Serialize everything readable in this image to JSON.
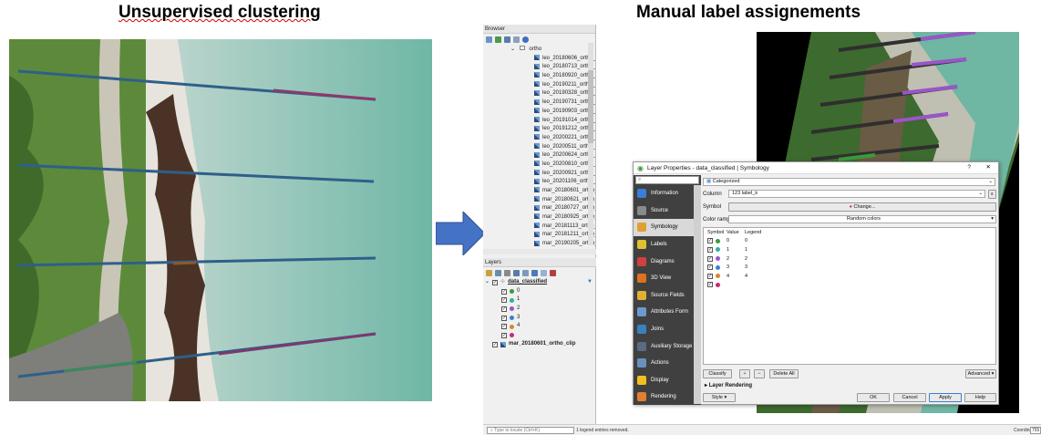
{
  "titles": {
    "left": "Unsupervised clustering",
    "right": "Manual label assignements"
  },
  "browser_panel": {
    "header": "Browser",
    "folder": "ortho",
    "items": [
      "leo_20180606_ortho_",
      "leo_20180713_ortho_",
      "leo_20180920_ortho_",
      "leo_20190211_ortho_",
      "leo_20190328_ortho_",
      "leo_20190731_ortho_",
      "leo_20190903_ortho_",
      "leo_20191014_ortho_",
      "leo_20191212_ortho_",
      "leo_20200221_ortho_",
      "leo_20200511_ortho_",
      "leo_20200624_ortho_",
      "leo_20200810_ortho_",
      "leo_20200921_ortho_",
      "leo_20201106_ortho_",
      "mar_20180601_ortho_",
      "mar_20180621_ortho_",
      "mar_20180727_ortho_",
      "mar_20180925_ortho_",
      "mar_20181113_ortho_",
      "mar_20181211_ortho_",
      "mar_20190205_ortho_"
    ]
  },
  "layers_panel": {
    "header": "Layers",
    "main_layer": "data_classified",
    "classes": [
      {
        "label": "0",
        "color": "#3a9a3a"
      },
      {
        "label": "1",
        "color": "#2fb0a0"
      },
      {
        "label": "2",
        "color": "#9a55c8"
      },
      {
        "label": "3",
        "color": "#3a7fd0"
      },
      {
        "label": "4",
        "color": "#d08a2a"
      },
      {
        "label": "",
        "color": "#c8287a"
      }
    ],
    "raster_layer": "mar_20180601_ortho_clip"
  },
  "statusbar": {
    "locate_placeholder": "Type to locate (Ctrl+K)",
    "message": "1 legend entries removed.",
    "coord_label": "Coordinate",
    "coord_value": "755"
  },
  "dialog": {
    "title": "Layer Properties - data_classified | Symbology",
    "help": "?",
    "close": "✕",
    "renderer": "Categorized",
    "column_label": "Column",
    "column_value": "123 label_k",
    "symbol_label": "Symbol",
    "symbol_value": "Change...",
    "ramp_label": "Color ramp",
    "ramp_value": "Random colors",
    "table_headers": [
      "Symbol",
      "Value",
      "Legend"
    ],
    "rows": [
      {
        "value": "0",
        "legend": "0",
        "color": "#3a9a3a"
      },
      {
        "value": "1",
        "legend": "1",
        "color": "#2fb0a0"
      },
      {
        "value": "2",
        "legend": "2",
        "color": "#9a55c8"
      },
      {
        "value": "3",
        "legend": "3",
        "color": "#3a7fd0"
      },
      {
        "value": "4",
        "legend": "4",
        "color": "#d08a2a"
      },
      {
        "value": "",
        "legend": "",
        "color": "#c8287a"
      }
    ],
    "sidebar": [
      {
        "label": "Information",
        "color": "#3b7dd8"
      },
      {
        "label": "Source",
        "color": "#8a8a8a"
      },
      {
        "label": "Symbology",
        "color": "#e0a030"
      },
      {
        "label": "Labels",
        "color": "#e0c030"
      },
      {
        "label": "Diagrams",
        "color": "#d04040"
      },
      {
        "label": "3D View",
        "color": "#e07020"
      },
      {
        "label": "Source Fields",
        "color": "#e0b030"
      },
      {
        "label": "Attributes Form",
        "color": "#6a9ad0"
      },
      {
        "label": "Joins",
        "color": "#3a80c0"
      },
      {
        "label": "Auxiliary Storage",
        "color": "#5a6a80"
      },
      {
        "label": "Actions",
        "color": "#6a90c0"
      },
      {
        "label": "Display",
        "color": "#f0c020"
      },
      {
        "label": "Rendering",
        "color": "#e08030"
      }
    ],
    "buttons": {
      "classify": "Classify",
      "delete_all": "Delete All",
      "advanced": "Advanced",
      "layer_rendering": "Layer Rendering",
      "style": "Style",
      "ok": "OK",
      "cancel": "Cancel",
      "apply": "Apply",
      "help": "Help"
    }
  }
}
